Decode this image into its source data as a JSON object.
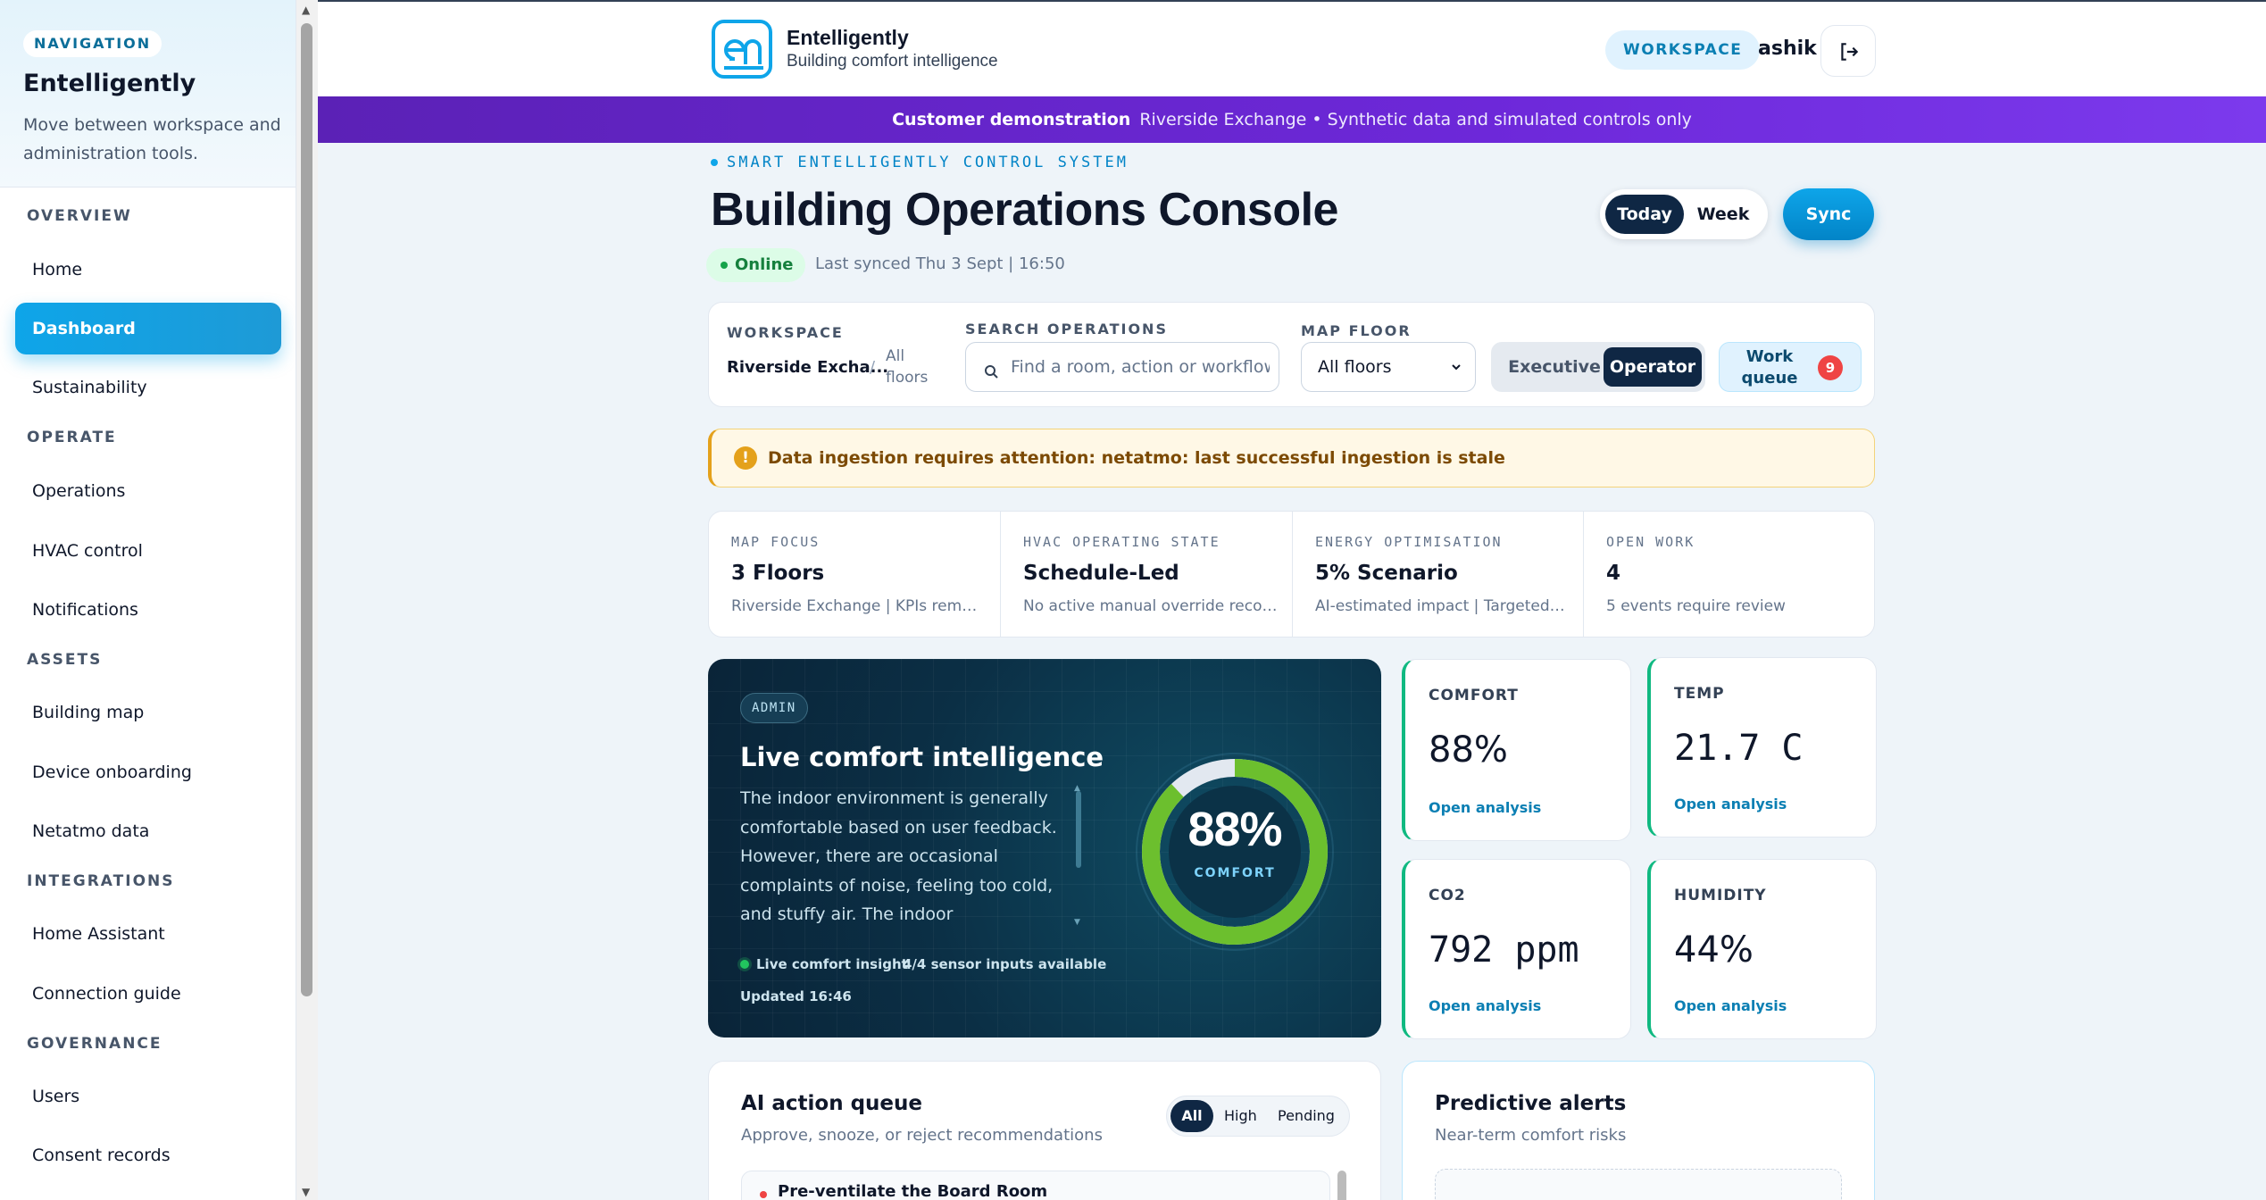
{
  "sidebar": {
    "nav_tag": "NAVIGATION",
    "title": "Entelligently",
    "description": "Move between workspace and administration tools.",
    "sections": [
      {
        "label": "OVERVIEW",
        "items": [
          "Home",
          "Dashboard",
          "Sustainability"
        ]
      },
      {
        "label": "OPERATE",
        "items": [
          "Operations",
          "HVAC control",
          "Notifications"
        ]
      },
      {
        "label": "ASSETS",
        "items": [
          "Building map",
          "Device onboarding",
          "Netatmo data"
        ]
      },
      {
        "label": "INTEGRATIONS",
        "items": [
          "Home Assistant",
          "Connection guide"
        ]
      },
      {
        "label": "GOVERNANCE",
        "items": [
          "Users",
          "Consent records"
        ]
      }
    ],
    "active_item": "Dashboard"
  },
  "header": {
    "brand": "Entelligently",
    "tagline": "Building comfort intelligence",
    "workspace_pill": "WORKSPACE",
    "user": "ashik",
    "logout_icon": "logout-icon"
  },
  "banner": {
    "label": "Customer demonstration",
    "text": "Riverside Exchange • Synthetic data and simulated controls only"
  },
  "page": {
    "eyebrow": "SMART ENTELLIGENTLY CONTROL SYSTEM",
    "title": "Building Operations Console",
    "status": "Online",
    "last_synced": "Last synced Thu 3 Sept | 16:50",
    "range_today": "Today",
    "range_week": "Week",
    "sync": "Sync"
  },
  "filters": {
    "workspace_label": "WORKSPACE",
    "workspace_value": "Riverside Excha...",
    "workspace_sep": "/",
    "workspace_floors": "All floors",
    "search_label": "SEARCH OPERATIONS",
    "search_placeholder": "Find a room, action or workflow...",
    "floor_label": "MAP FLOOR",
    "floor_value": "All floors",
    "mode_executive": "Executive",
    "mode_operator": "Operator",
    "work_queue": "Work queue",
    "work_queue_count": "9"
  },
  "alert": {
    "icon": "!",
    "text": "Data ingestion requires attention: netatmo: last successful ingestion is stale"
  },
  "kpis": [
    {
      "label": "MAP FOCUS",
      "value": "3 Floors",
      "sub": "Riverside Exchange | KPIs remain ..."
    },
    {
      "label": "HVAC OPERATING STATE",
      "value": "Schedule-Led",
      "sub": "No active manual override recorded"
    },
    {
      "label": "ENERGY OPTIMISATION",
      "value": "5% Scenario",
      "sub": "AI-estimated impact | Targeted zo..."
    },
    {
      "label": "OPEN WORK",
      "value": "4",
      "sub": "5 events require review"
    }
  ],
  "hero": {
    "badge": "ADMIN",
    "title": "Live comfort intelligence",
    "text": "The indoor environment is generally comfortable based on user feedback. However, there are occasional complaints of noise, feeling too cold, and stuffy air. The indoor temperature is",
    "live": "Live comfort insight",
    "sensors": "4/4 sensor inputs available",
    "updated": "Updated 16:46",
    "ring_value": "88%",
    "ring_label": "COMFORT",
    "comfort_fraction": 0.88
  },
  "metrics": [
    {
      "label": "COMFORT",
      "value": "88%",
      "action": "Open analysis"
    },
    {
      "label": "TEMP",
      "value": "21.7 C",
      "action": "Open analysis"
    },
    {
      "label": "CO2",
      "value": "792 ppm",
      "action": "Open analysis"
    },
    {
      "label": "HUMIDITY",
      "value": "44%",
      "action": "Open analysis"
    }
  ],
  "ai_queue": {
    "title": "AI action queue",
    "subtitle": "Approve, snooze, or reject recommendations",
    "filter_all": "All",
    "filter_high": "High",
    "filter_pending": "Pending",
    "first_item": "Pre-ventilate the Board Room"
  },
  "predictive": {
    "title": "Predictive alerts",
    "subtitle": "Near-term comfort risks"
  },
  "colors": {
    "accent": "#0ea5e9",
    "banner": "#6d28d9",
    "ring_green": "#6cbf2e",
    "alert": "#e4a11b"
  }
}
